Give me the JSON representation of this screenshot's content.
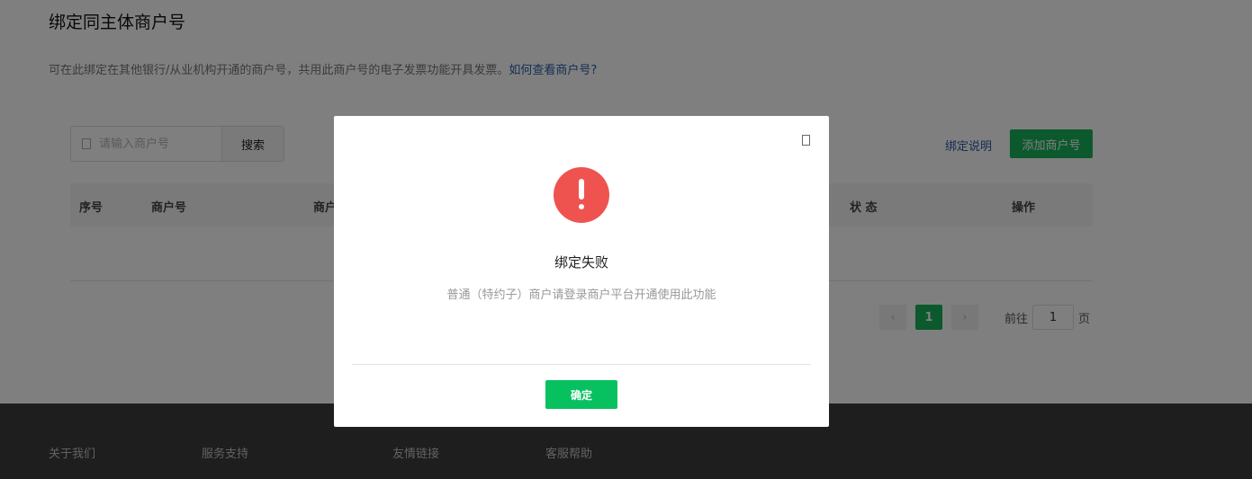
{
  "page": {
    "title": "绑定同主体商户号",
    "description": "可在此绑定在其他银行/从业机构开通的商户号，共用此商户号的电子发票功能开具发票。",
    "help_link": "如何查看商户号?"
  },
  "toolbar": {
    "search_placeholder": "请输入商户号",
    "search_button": "搜索",
    "bind_desc_link": "绑定说明",
    "add_button": "添加商户号"
  },
  "table": {
    "columns": [
      "序号",
      "商户号",
      "商户",
      "状 态",
      "操作"
    ]
  },
  "pagination": {
    "current_page": "1",
    "goto_prefix": "前往",
    "goto_value": "1",
    "goto_suffix": "页"
  },
  "footer": {
    "links": [
      "关于我们",
      "服务支持",
      "友情链接",
      "客服帮助"
    ]
  },
  "modal": {
    "title": "绑定失败",
    "message": "普通（特约子）商户请登录商户平台开通使用此功能",
    "ok_button": "确定"
  },
  "colors": {
    "accent_green": "#19b35a",
    "alert_red": "#ef5350",
    "link_blue": "#2b5ba8"
  }
}
